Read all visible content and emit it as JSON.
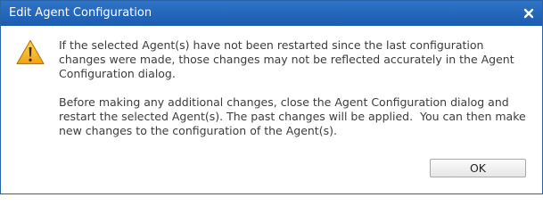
{
  "dialog": {
    "title": "Edit Agent Configuration",
    "close_icon": "close-icon",
    "warning_icon": "warning-triangle-icon",
    "message": {
      "paragraph1": "If the selected Agent(s) have not been restarted since the last configuration changes were made, those changes may not be reflected accurately in the Agent Configuration dialog.",
      "paragraph2": "Before making any additional changes, close the Agent Configuration dialog and restart the selected Agent(s). The past changes will be applied.  You can then make new changes to the configuration of the Agent(s)."
    },
    "ok_label": "OK",
    "colors": {
      "titlebar": "#1b5bb0",
      "border": "#2a63a8",
      "warning_fill": "#f5b62a",
      "warning_outline": "#b87c00"
    }
  }
}
